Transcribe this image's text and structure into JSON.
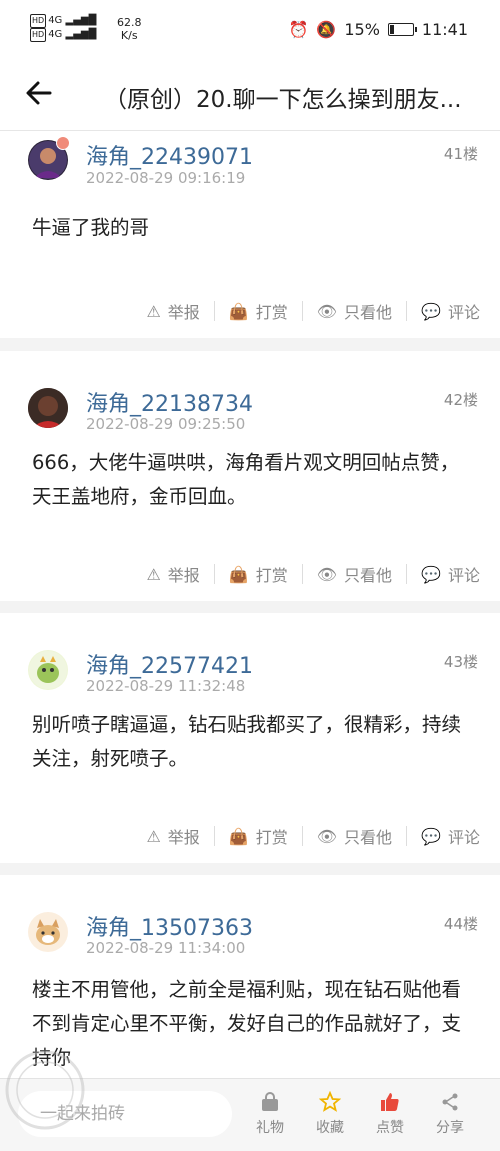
{
  "status_bar": {
    "net1": "4G",
    "net2": "4G",
    "speed_value": "62.8",
    "speed_unit": "K/s",
    "battery": "15%",
    "time": "11:41"
  },
  "header": {
    "title": "（原创）20.聊一下怎么操到朋友..."
  },
  "action_labels": {
    "report": "举报",
    "tip": "打赏",
    "only_him": "只看他",
    "comment": "评论"
  },
  "posts": [
    {
      "username": "海角_22439071",
      "time": "2022-08-29 09:16:19",
      "floor": "41楼",
      "content": "牛逼了我的哥"
    },
    {
      "username": "海角_22138734",
      "time": "2022-08-29 09:25:50",
      "floor": "42楼",
      "content": "666，大佬牛逼哄哄，海角看片观文明回帖点赞，天王盖地府，金币回血。"
    },
    {
      "username": "海角_22577421",
      "time": "2022-08-29 11:32:48",
      "floor": "43楼",
      "content": "别听喷子瞎逼逼，钻石贴我都买了，很精彩，持续关注，射死喷子。"
    },
    {
      "username": "海角_13507363",
      "time": "2022-08-29 11:34:00",
      "floor": "44楼",
      "content": "楼主不用管他，之前全是福利贴，现在钻石贴他看不到肯定心里不平衡，发好自己的作品就好了，支持你"
    }
  ],
  "bottom_bar": {
    "reply_placeholder": "一起来拍砖",
    "gift": "礼物",
    "favorite": "收藏",
    "like": "点赞",
    "share": "分享"
  },
  "colors": {
    "username": "#3d6a97",
    "like_accent": "#e84a3c",
    "favorite_accent": "#f0b400"
  }
}
